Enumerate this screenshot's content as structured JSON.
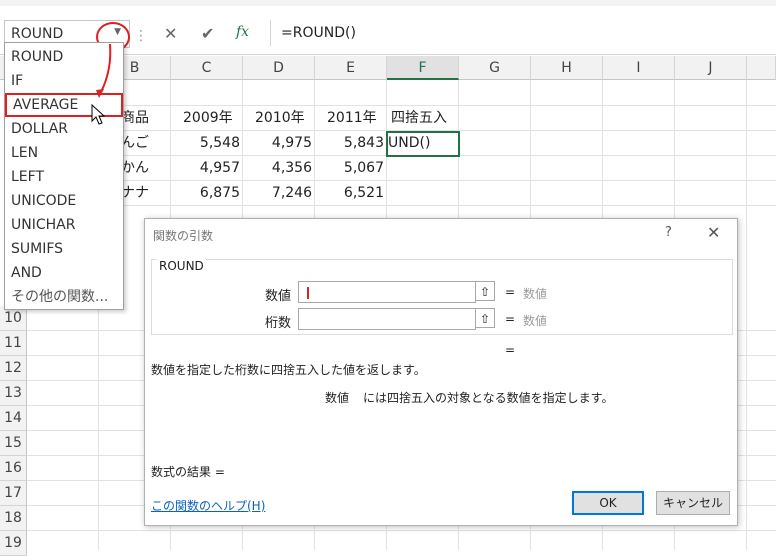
{
  "formula_bar": {
    "name_box": "ROUND",
    "cancel_icon": "✕",
    "enter_icon": "✔",
    "fx_label": "fx",
    "formula": "=ROUND()"
  },
  "columns": [
    "B",
    "C",
    "D",
    "E",
    "F",
    "G",
    "H",
    "I",
    "J"
  ],
  "rows": [
    "10",
    "11",
    "12",
    "13",
    "14",
    "15",
    "16",
    "17",
    "18",
    "19"
  ],
  "sheet": {
    "header": {
      "b": "商品",
      "c": "2009年",
      "d": "2010年",
      "e": "2011年",
      "f": "四捨五入"
    },
    "data_rows": [
      {
        "b": "んご",
        "c": "5,548",
        "d": "4,975",
        "e": "5,843"
      },
      {
        "b": "かん",
        "c": "4,957",
        "d": "4,356",
        "e": "5,067"
      },
      {
        "b": "ナナ",
        "c": "6,875",
        "d": "7,246",
        "e": "6,521"
      }
    ],
    "active_cell": "UND()"
  },
  "dropdown": {
    "items": [
      "ROUND",
      "IF",
      "AVERAGE",
      "DOLLAR",
      "LEN",
      "LEFT",
      "UNICODE",
      "UNICHAR",
      "SUMIFS",
      "AND",
      "その他の関数..."
    ],
    "highlighted": "AVERAGE"
  },
  "dialog": {
    "title": "関数の引数",
    "help_mark": "?",
    "close": "✕",
    "function_name": "ROUND",
    "arg1_label": "数値",
    "arg2_label": "桁数",
    "ref_icon": "⇧",
    "eq": "=",
    "arg1_hint": "数値",
    "arg2_hint": "数値",
    "summary": "数値を指定した桁数に四捨五入した値を返します。",
    "arg_desc_name": "数値",
    "arg_desc": "には四捨五入の対象となる数値を指定します。",
    "result_label": "数式の結果 =",
    "help_link": "この関数のヘルプ(H)",
    "ok": "OK",
    "cancel": "キャンセル"
  },
  "colors": {
    "accent": "#217346",
    "annotation": "#e02020",
    "link": "#0b62c4"
  }
}
